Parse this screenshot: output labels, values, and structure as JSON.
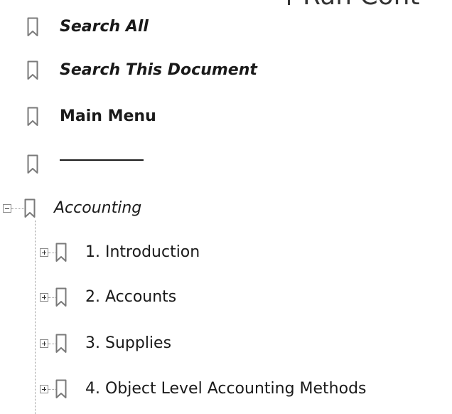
{
  "top_partial_text": "Run Cont",
  "bookmarks": {
    "search_all": "Search All",
    "search_this_document": "Search This Document",
    "main_menu": "Main Menu",
    "accounting": "Accounting",
    "children": [
      {
        "label": "1. Introduction"
      },
      {
        "label": "2. Accounts"
      },
      {
        "label": "3. Supplies"
      },
      {
        "label": "4. Object Level Accounting Methods"
      }
    ]
  },
  "icons": {
    "bookmark": "bookmark-icon",
    "expand": "expand-icon",
    "collapse": "collapse-icon"
  },
  "colors": {
    "icon_stroke": "#7a7a7a",
    "text": "#1a1a1a"
  }
}
